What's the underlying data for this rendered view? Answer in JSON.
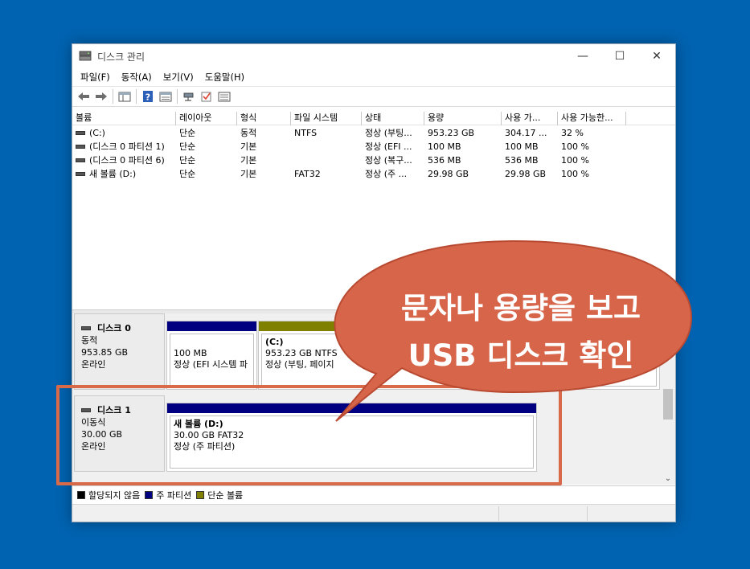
{
  "window": {
    "title": "디스크 관리",
    "controls": {
      "minimize": "—",
      "maximize": "☐",
      "close": "✕"
    }
  },
  "menu": [
    "파일(F)",
    "동작(A)",
    "보기(V)",
    "도움말(H)"
  ],
  "toolbar": {
    "icons": [
      "back-arrow-icon",
      "forward-arrow-icon",
      "console-tree-icon",
      "help-icon",
      "properties-icon",
      "connect-icon",
      "check-icon",
      "list-icon"
    ]
  },
  "volume_list": {
    "columns": [
      "볼륨",
      "레이아웃",
      "형식",
      "파일 시스템",
      "상태",
      "용량",
      "사용 가...",
      "사용 가능한..."
    ],
    "rows": [
      [
        "(C:)",
        "단순",
        "동적",
        "NTFS",
        "정상 (부팅...",
        "953.23 GB",
        "304.17 ...",
        "32 %"
      ],
      [
        "(디스크 0 파티션 1)",
        "단순",
        "기본",
        "",
        "정상 (EFI ...",
        "100 MB",
        "100 MB",
        "100 %"
      ],
      [
        "(디스크 0 파티션 6)",
        "단순",
        "기본",
        "",
        "정상 (복구...",
        "536 MB",
        "536 MB",
        "100 %"
      ],
      [
        "새 볼륨 (D:)",
        "단순",
        "기본",
        "FAT32",
        "정상 (주 ...",
        "29.98 GB",
        "29.98 GB",
        "100 %"
      ]
    ]
  },
  "disks": [
    {
      "name": "디스크 0",
      "type": "동적",
      "size": "953.85 GB",
      "status": "온라인",
      "partitions": [
        {
          "title": "",
          "line1": "100 MB",
          "line2": "정상 (EFI 시스템 파",
          "bar_color": "#000080"
        },
        {
          "title": "(C:)",
          "line1": "953.23 GB NTFS",
          "line2": "정상 (부팅, 페이지",
          "bar_color": "#808000"
        }
      ]
    },
    {
      "name": "디스크 1",
      "type": "이동식",
      "size": "30.00 GB",
      "status": "온라인",
      "partitions": [
        {
          "title": "새 볼륨  (D:)",
          "line1": "30.00 GB FAT32",
          "line2": "정상 (주 파티션)",
          "bar_color": "#000080"
        }
      ]
    }
  ],
  "legend": [
    {
      "label": "할당되지 않음",
      "color": "#000000"
    },
    {
      "label": "주 파티션",
      "color": "#000080"
    },
    {
      "label": "단순 볼륨",
      "color": "#808000"
    }
  ],
  "callout": {
    "line1": "문자나 용량을 보고",
    "line2": "USB 디스크 확인",
    "fill_color": "#d7654a",
    "border_color": "#b94a32"
  }
}
